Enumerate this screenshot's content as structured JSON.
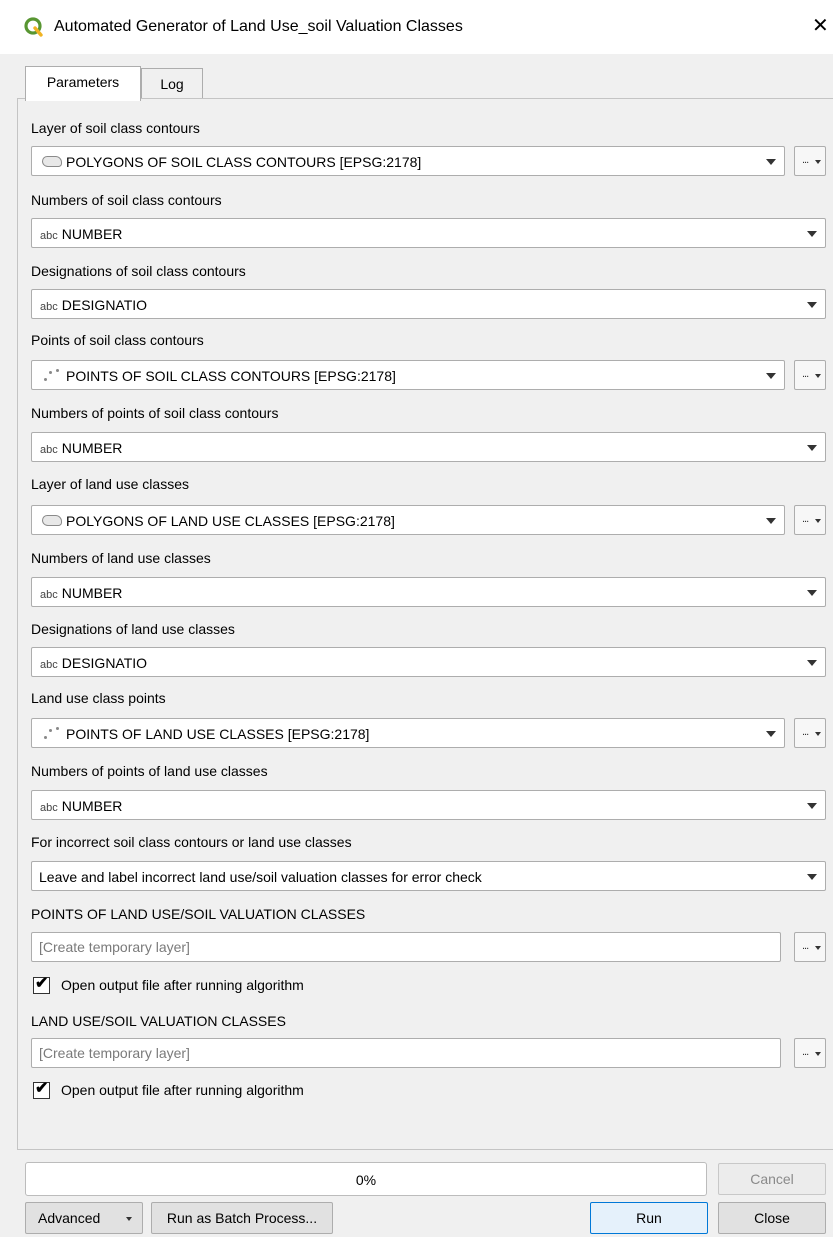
{
  "window": {
    "title": "Automated Generator of Land Use_soil Valuation Classes",
    "close_glyph": "✕"
  },
  "tabs": [
    {
      "label": "Parameters",
      "active": true
    },
    {
      "label": "Log",
      "active": false
    }
  ],
  "params": {
    "soil_layer": {
      "label": "Layer of soil class contours",
      "value": "POLYGONS OF SOIL CLASS CONTOURS [EPSG:2178]",
      "icon": "polygon-layer-icon"
    },
    "soil_numbers": {
      "label": "Numbers of soil class contours",
      "value": "NUMBER",
      "icon": "abc"
    },
    "soil_designations": {
      "label": "Designations of soil class contours",
      "value": "DESIGNATIO",
      "icon": "abc"
    },
    "soil_points": {
      "label": "Points of soil class contours",
      "value": "POINTS OF SOIL CLASS CONTOURS [EPSG:2178]",
      "icon": "point-layer-icon"
    },
    "soil_point_numbers": {
      "label": "Numbers of points of soil class contours",
      "value": "NUMBER",
      "icon": "abc"
    },
    "landuse_layer": {
      "label": "Layer of land use classes",
      "value": "POLYGONS OF LAND USE CLASSES [EPSG:2178]",
      "icon": "polygon-layer-icon"
    },
    "landuse_numbers": {
      "label": "Numbers of land use classes",
      "value": "NUMBER",
      "icon": "abc"
    },
    "landuse_designations": {
      "label": "Designations of land use classes",
      "value": "DESIGNATIO",
      "icon": "abc"
    },
    "landuse_points": {
      "label": "Land use class points",
      "value": "POINTS OF LAND USE CLASSES [EPSG:2178]",
      "icon": "point-layer-icon"
    },
    "landuse_point_numbers": {
      "label": "Numbers of points of land use classes",
      "value": "NUMBER",
      "icon": "abc"
    },
    "incorrect_mode": {
      "label": "For incorrect soil class contours or land use classes",
      "value": "Leave and label incorrect land use/soil valuation classes for error check"
    }
  },
  "field_icon_text": "abc",
  "outputs": [
    {
      "label": "POINTS OF LAND USE/SOIL VALUATION CLASSES",
      "value": "",
      "placeholder": "[Create temporary layer]",
      "open_after_label": "Open output file after running algorithm",
      "open_after_checked": true
    },
    {
      "label": "LAND USE/SOIL VALUATION CLASSES",
      "value": "",
      "placeholder": "[Create temporary layer]",
      "open_after_label": "Open output file after running algorithm",
      "open_after_checked": true
    }
  ],
  "checkmark": "✔",
  "progress": {
    "text": "0%",
    "fraction": 0
  },
  "buttons": {
    "cancel": "Cancel",
    "advanced": "Advanced",
    "batch": "Run as Batch Process...",
    "run": "Run",
    "close": "Close",
    "browse": "..."
  },
  "colors": {
    "accent": "#0078d7",
    "progress_fill": "#06b025",
    "logo": "#589632"
  }
}
